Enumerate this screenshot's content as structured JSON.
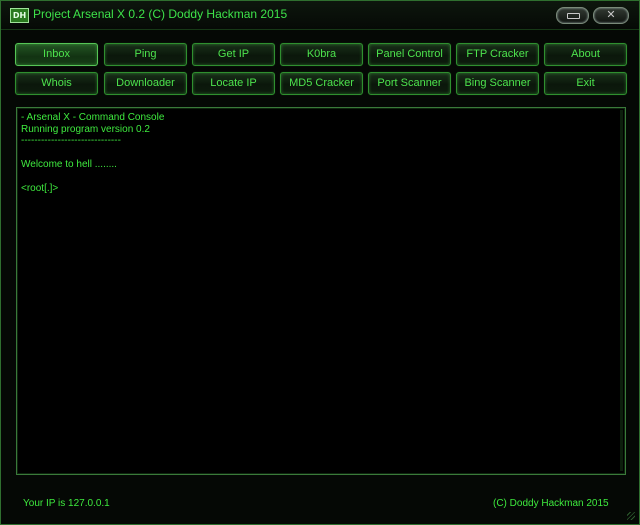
{
  "window": {
    "icon_text": "DH",
    "title": "Project Arsenal X 0.2 (C) Doddy Hackman 2015"
  },
  "buttons": {
    "row1": [
      "Inbox",
      "Ping",
      "Get IP",
      "K0bra",
      "Panel Control",
      "FTP Cracker",
      "About"
    ],
    "row2": [
      "Whois",
      "Downloader",
      "Locate IP",
      "MD5 Cracker",
      "Port Scanner",
      "Bing Scanner",
      "Exit"
    ]
  },
  "console": {
    "lines": [
      "- Arsenal X - Command Console",
      "Running program version 0.2",
      "------------------------------",
      "Welcome to hell ........",
      "<root[.]>"
    ]
  },
  "status": {
    "ip_text": "Your IP is 127.0.0.1",
    "copyright": "(C) Doddy Hackman 2015"
  },
  "colors": {
    "accent": "#3eea3e",
    "border": "#2f8f2f",
    "background": "#000000"
  }
}
